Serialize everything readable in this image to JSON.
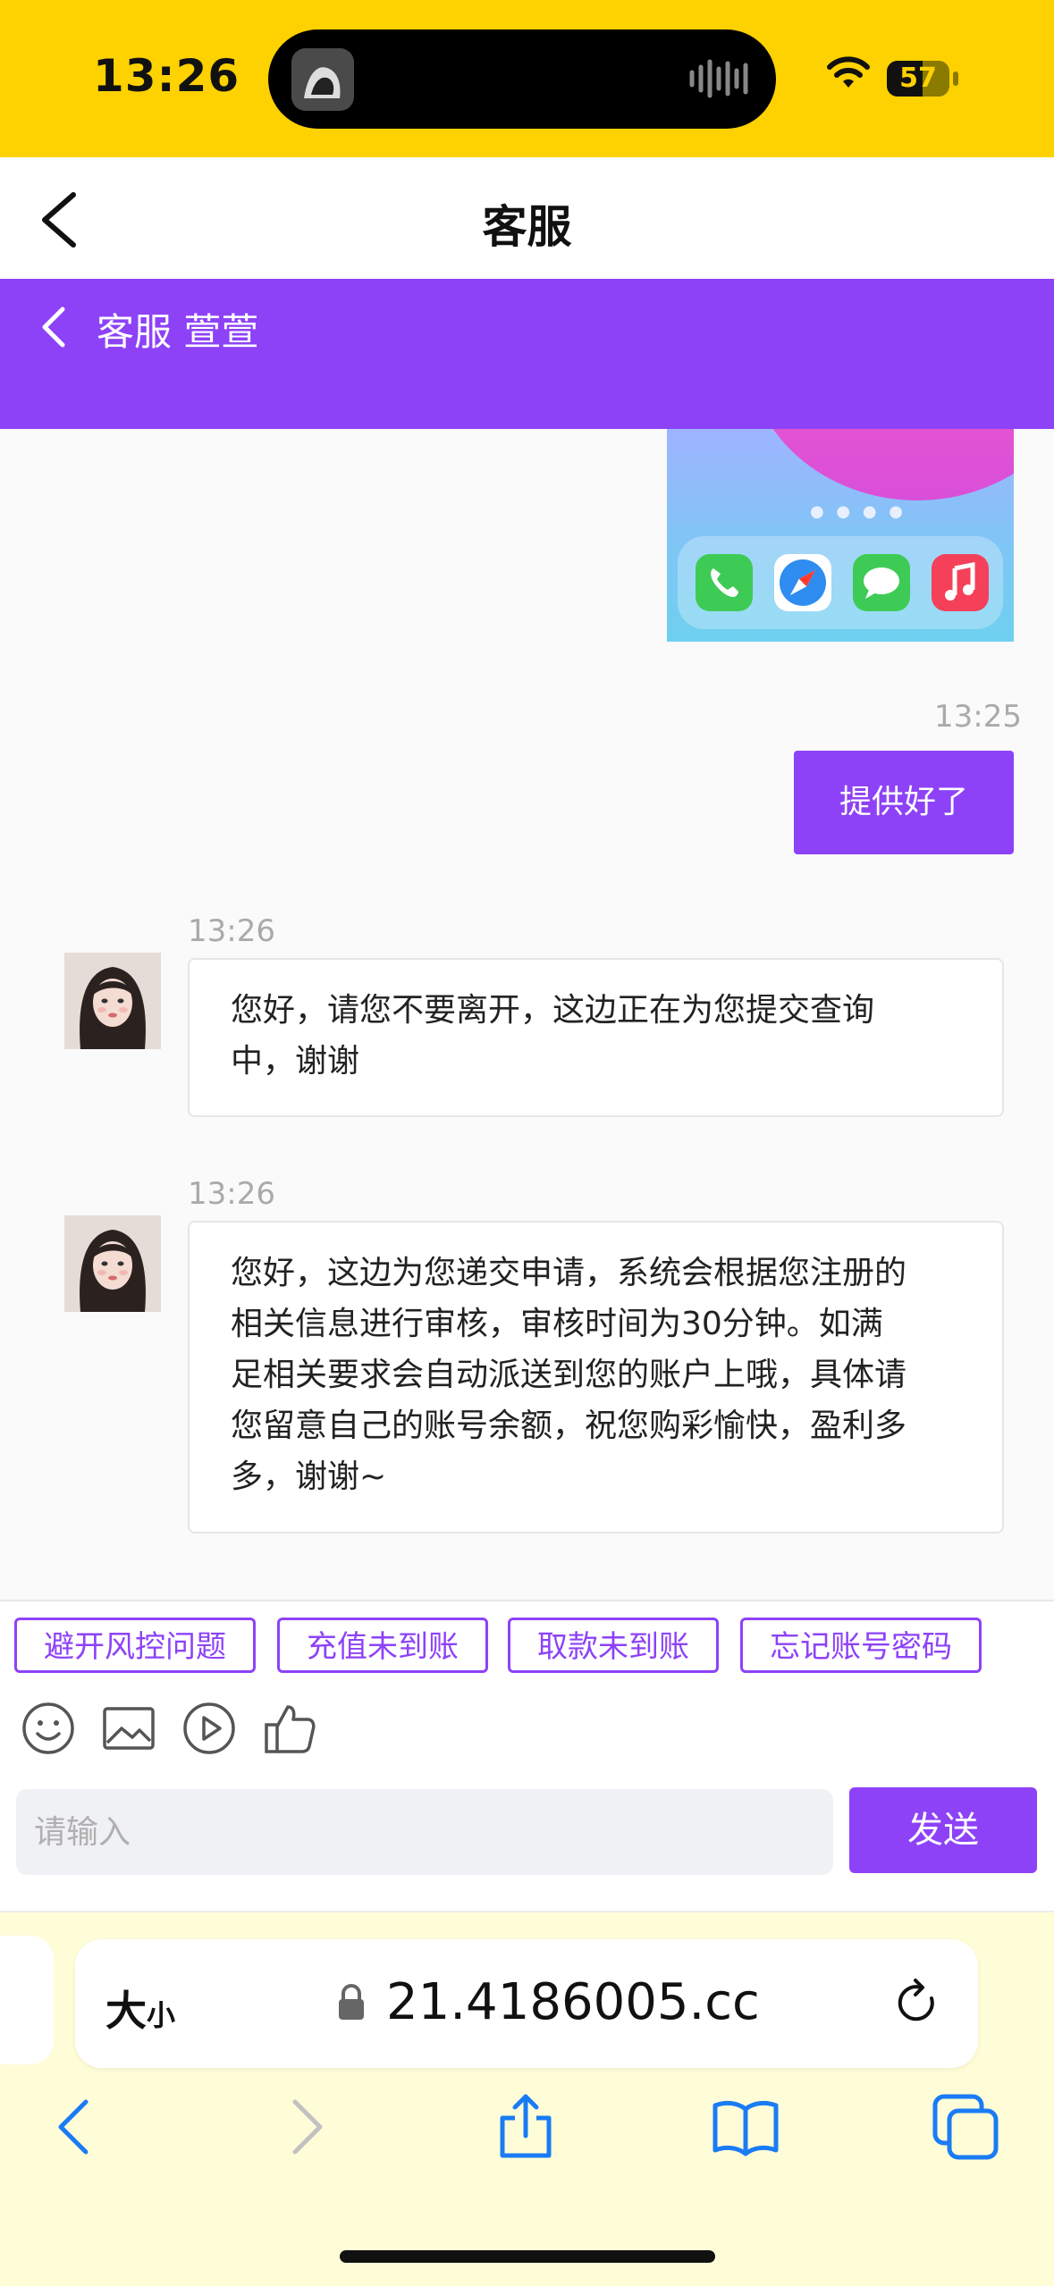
{
  "status_bar": {
    "time": "13:26",
    "battery": "57",
    "battery_level_percent": 57,
    "icons": [
      "island-thumbnail-icon",
      "audio-wave-icon",
      "wifi-icon",
      "battery-icon"
    ]
  },
  "nav": {
    "title": "客服",
    "back_icon": "chevron-left-icon"
  },
  "chat_header": {
    "title": "客服 萱萱",
    "back_icon": "chevron-left-icon"
  },
  "messages": [
    {
      "type": "image",
      "direction": "out",
      "description_icons": [
        "phone-icon",
        "safari-icon",
        "messages-icon",
        "music-icon"
      ]
    },
    {
      "type": "text",
      "direction": "out",
      "time": "13:25",
      "text": "提供好了"
    },
    {
      "type": "text",
      "direction": "in",
      "time": "13:26",
      "lines": [
        "您好，请您不要离开，这边正在为您提交查询",
        "中，谢谢"
      ]
    },
    {
      "type": "text",
      "direction": "in",
      "time": "13:26",
      "lines": [
        "您好，这边为您递交申请，系统会根据您注册的",
        "相关信息进行审核，审核时间为30分钟。如满",
        "足相关要求会自动派送到您的账户上哦，具体请",
        "您留意自己的账号余额，祝您购彩愉快，盈利多",
        "多，谢谢~"
      ]
    }
  ],
  "quick_replies": [
    "避开风控问题",
    "充值未到账",
    "取款未到账",
    "忘记账号密码"
  ],
  "toolbar_icons": [
    "emoji-icon",
    "image-icon",
    "video-icon",
    "thumbs-up-icon"
  ],
  "composer": {
    "placeholder": "请输入",
    "send_label": "发送"
  },
  "browser": {
    "text_size_label_big": "大",
    "text_size_label_small": "小",
    "url": "21.4186005.cc",
    "icons": [
      "lock-icon",
      "reload-icon",
      "back-icon",
      "forward-icon",
      "share-icon",
      "bookmarks-icon",
      "tabs-icon"
    ]
  },
  "colors": {
    "status_bar": "#fed100",
    "accent": "#8d42f7",
    "browser_bar": "#fffdd8"
  }
}
